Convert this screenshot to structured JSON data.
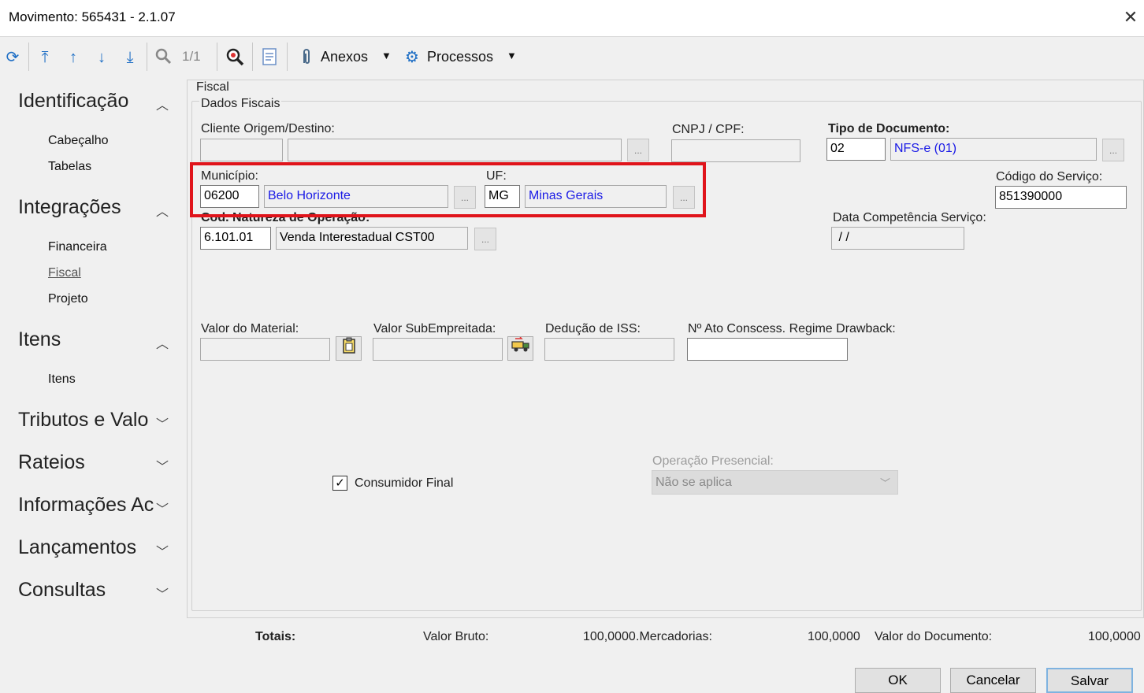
{
  "window": {
    "title": "Movimento: 565431 - 2.1.07",
    "close_glyph": "✕"
  },
  "toolbar": {
    "pager": "1/1",
    "anexos_label": "Anexos",
    "processos_label": "Processos",
    "icons": [
      "refresh-icon",
      "first-record-icon",
      "previous-record-icon",
      "next-record-icon",
      "last-record-icon",
      "search-icon",
      "zoom-search-icon",
      "report-icon",
      "paperclip-icon",
      "gear-icon"
    ]
  },
  "sidebar": {
    "groups": [
      {
        "label": "Identificação",
        "expanded": true,
        "items": [
          "Cabeçalho",
          "Tabelas"
        ]
      },
      {
        "label": "Integrações",
        "expanded": true,
        "items": [
          "Financeira",
          "Fiscal",
          "Projeto"
        ]
      },
      {
        "label": "Itens",
        "expanded": true,
        "items": [
          "Itens"
        ]
      },
      {
        "label": "Tributos e Valo",
        "expanded": false,
        "items": []
      },
      {
        "label": "Rateios",
        "expanded": false,
        "items": []
      },
      {
        "label": "Informações Ac",
        "expanded": false,
        "items": []
      },
      {
        "label": "Lançamentos",
        "expanded": false,
        "items": []
      },
      {
        "label": "Consultas",
        "expanded": false,
        "items": []
      }
    ],
    "active_item": "Fiscal"
  },
  "form": {
    "panel_title": "Fiscal",
    "section_title": "Dados Fiscais",
    "cliente": {
      "label": "Cliente Origem/Destino:",
      "code": "",
      "name": ""
    },
    "cnpj": {
      "label": "CNPJ / CPF:",
      "value": ""
    },
    "tipo_documento": {
      "label": "Tipo de Documento:",
      "code": "02",
      "name": "NFS-e (01)"
    },
    "municipio": {
      "label": "Município:",
      "code": "06200",
      "name": "Belo Horizonte"
    },
    "uf": {
      "label": "UF:",
      "code": "MG",
      "name": "Minas Gerais"
    },
    "codigo_servico": {
      "label": "Código do Serviço:",
      "value": "851390000"
    },
    "natureza": {
      "label": "Cod. Natureza de Operação:",
      "code": "6.101.01",
      "name": "Venda Interestadual CST00"
    },
    "data_competencia": {
      "label": "Data Competência Serviço:",
      "value": " / /"
    },
    "valor_material": {
      "label": "Valor do Material:",
      "value": ""
    },
    "valor_subempreitada": {
      "label": "Valor SubEmpreitada:",
      "value": ""
    },
    "deducao_iss": {
      "label": "Dedução de ISS:",
      "value": ""
    },
    "ato_concessorio": {
      "label": "Nº Ato Conscess. Regime Drawback:",
      "value": ""
    },
    "consumidor_final": {
      "label": "Consumidor Final",
      "checked": true,
      "check_glyph": "✓"
    },
    "operacao_presencial": {
      "label": "Operação Presencial:",
      "value": "Não se aplica",
      "enabled": false
    },
    "lookup_glyph": "..."
  },
  "totals": {
    "label": "Totais:",
    "valor_bruto_label": "Valor Bruto:",
    "valor_bruto": "100,0000",
    "mercadorias_label": ".Mercadorias:",
    "mercadorias": "100,0000",
    "valor_documento_label": "Valor do Documento:",
    "valor_documento": "100,0000"
  },
  "buttons": {
    "ok": "OK",
    "cancel": "Cancelar",
    "save": "Salvar"
  },
  "colors": {
    "highlight": "#e0141b",
    "link_blue": "#1a1ae6",
    "toolbar_icon": "#1f6fc5"
  }
}
